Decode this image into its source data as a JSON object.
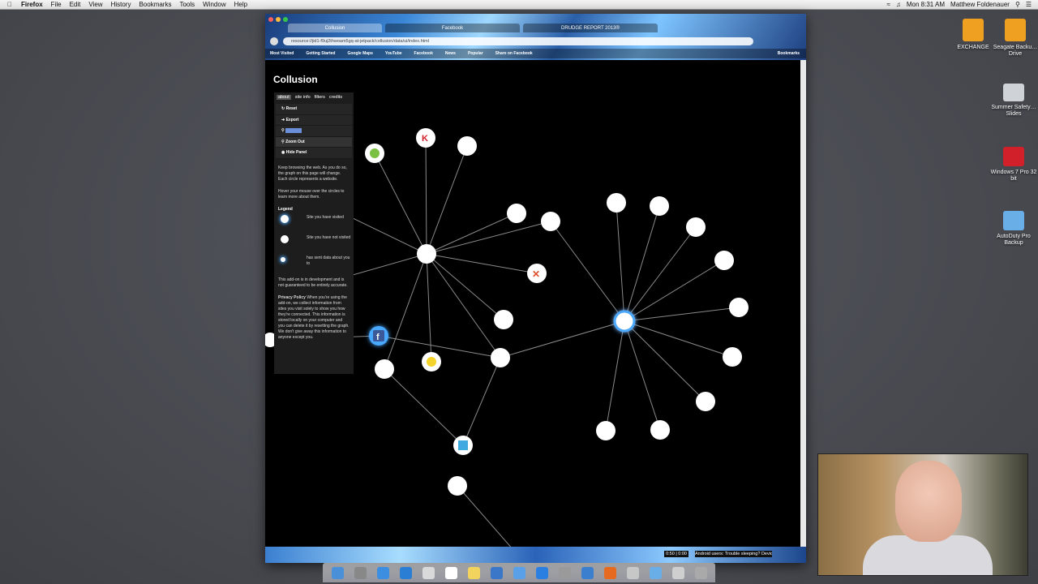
{
  "menubar": {
    "app": "Firefox",
    "items": [
      "File",
      "Edit",
      "View",
      "History",
      "Bookmarks",
      "Tools",
      "Window",
      "Help"
    ],
    "clock": "Mon 8:31 AM",
    "user": "Matthew Foldenauer"
  },
  "desktop_icons": [
    {
      "label": "EXCHANGE",
      "color": "#f0a020"
    },
    {
      "label": "Seagate Backu…Drive",
      "color": "#f0a020"
    },
    {
      "label": "Summer Safety…Slides",
      "color": "#cfd3d8"
    },
    {
      "label": "Windows 7 Pro 32 bit",
      "color": "#d2202a"
    },
    {
      "label": "AutoDuty Pro Backup",
      "color": "#6aaee8"
    }
  ],
  "browser": {
    "tabs": [
      "Collusion",
      "Facebook",
      "DRUDGE REPORT 2013®"
    ],
    "url": "resource://jid1-f9uj2thwoam5gq-at-jetpack/collusion/data/ui/index.html",
    "bookmarks": [
      "Most Visited",
      "Getting Started",
      "Google Maps",
      "YouTube",
      "Facebook",
      "News",
      "Popular",
      "Share on Facebook"
    ],
    "bookmarks_right": "Bookmarks",
    "status_time": "0:50 | 0:00",
    "status_text": "Android users: Trouble sleeping? Device o"
  },
  "collusion": {
    "title": "Collusion",
    "tabs": [
      "about",
      "site info",
      "filters",
      "credits"
    ],
    "menu": [
      "Reset",
      "Export",
      "Zoom In",
      "Zoom Out",
      "Hide Panel"
    ],
    "intro": "Keep browsing the web. As you do so, the graph on this page will change. Each circle represents a website.",
    "hover": "Hover your mouse over the circles to learn more about them.",
    "legend_title": "Legend",
    "legend": [
      "Site you have visited",
      "Site you have not visited",
      "has sent data about you to"
    ],
    "dev_note": "This add-on is in development and is not guaranteed to be entirely accurate.",
    "privacy_title": "Privacy Policy",
    "privacy": "When you're using the add-on, we collect information from sites you visit solely to show you how they're connected. This information is stored locally on your computer and you can delete it by resetting the graph. We don't give away this information to anyone except you."
  },
  "colors": {
    "visited_glow": "#4aa8ff",
    "node_fill": "#ffffff",
    "edge": "#8a8a8a"
  }
}
